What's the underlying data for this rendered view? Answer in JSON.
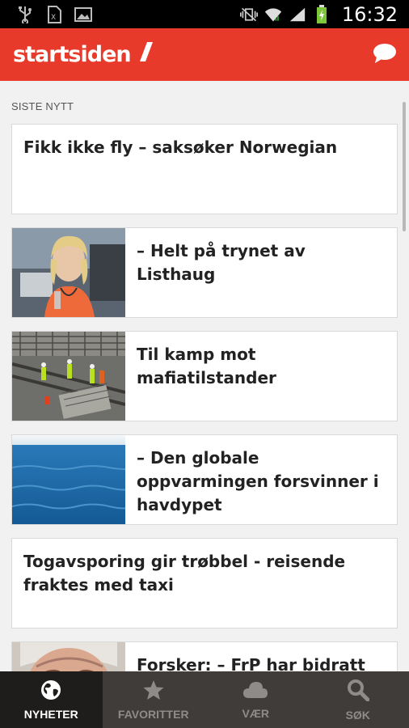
{
  "status_bar": {
    "time": "16:32",
    "icons": [
      "usb-icon",
      "sim-icon",
      "image-icon",
      "vibrate-mute-icon",
      "wifi-icon",
      "signal-icon",
      "battery-charging-icon"
    ]
  },
  "app_bar": {
    "logo_text": "startsiden",
    "action_icon": "chat-icon"
  },
  "feed": {
    "section_label": "SISTE NYTT",
    "articles": [
      {
        "title": "Fikk ikke fly – saksøker Norwegian",
        "has_image": false
      },
      {
        "title": "– Helt på trynet av Listhaug",
        "has_image": true,
        "image": "woman-portrait"
      },
      {
        "title": "Til kamp mot mafiatilstander",
        "has_image": true,
        "image": "construction-site"
      },
      {
        "title": "– Den globale oppvarmingen forsvinner i havdypet",
        "has_image": true,
        "image": "ocean-horizon"
      },
      {
        "title": "Togavsporing gir trøbbel - reisende fraktes med taxi",
        "has_image": false
      },
      {
        "title": "Forsker: – FrP har bidratt til",
        "has_image": true,
        "image": "man-portrait"
      }
    ]
  },
  "bottom_nav": {
    "items": [
      {
        "label": "NYHETER",
        "icon": "globe-icon",
        "active": true
      },
      {
        "label": "FAVORITTER",
        "icon": "star-icon",
        "active": false
      },
      {
        "label": "VÆR",
        "icon": "cloud-icon",
        "active": false
      },
      {
        "label": "SØK",
        "icon": "search-icon",
        "active": false
      }
    ]
  },
  "colors": {
    "brand_red": "#e73a2b",
    "nav_bg": "#3f3c3a",
    "nav_active_bg": "#1f1d1c"
  }
}
